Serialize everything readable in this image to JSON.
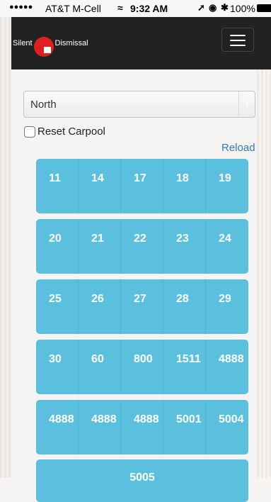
{
  "status_bar": {
    "signal": "●●●●●",
    "carrier": "AT&T M-Cell",
    "time": "9:32 AM",
    "battery": "100%"
  },
  "navbar": {
    "brand_left": "Silent",
    "brand_right": "Dismissal"
  },
  "zone_select": {
    "selected": "North"
  },
  "reset_carpool": {
    "label": "Reset Carpool",
    "checked": false
  },
  "reload_label": "Reload",
  "carpool_groups": [
    [
      "11",
      "14",
      "17",
      "18",
      "19"
    ],
    [
      "20",
      "21",
      "22",
      "23",
      "24"
    ],
    [
      "25",
      "26",
      "27",
      "28",
      "29"
    ],
    [
      "30",
      "60",
      "800",
      "1511",
      "4888"
    ],
    [
      "4888",
      "4888",
      "4888",
      "5001",
      "5004"
    ]
  ],
  "last_group": "5005"
}
